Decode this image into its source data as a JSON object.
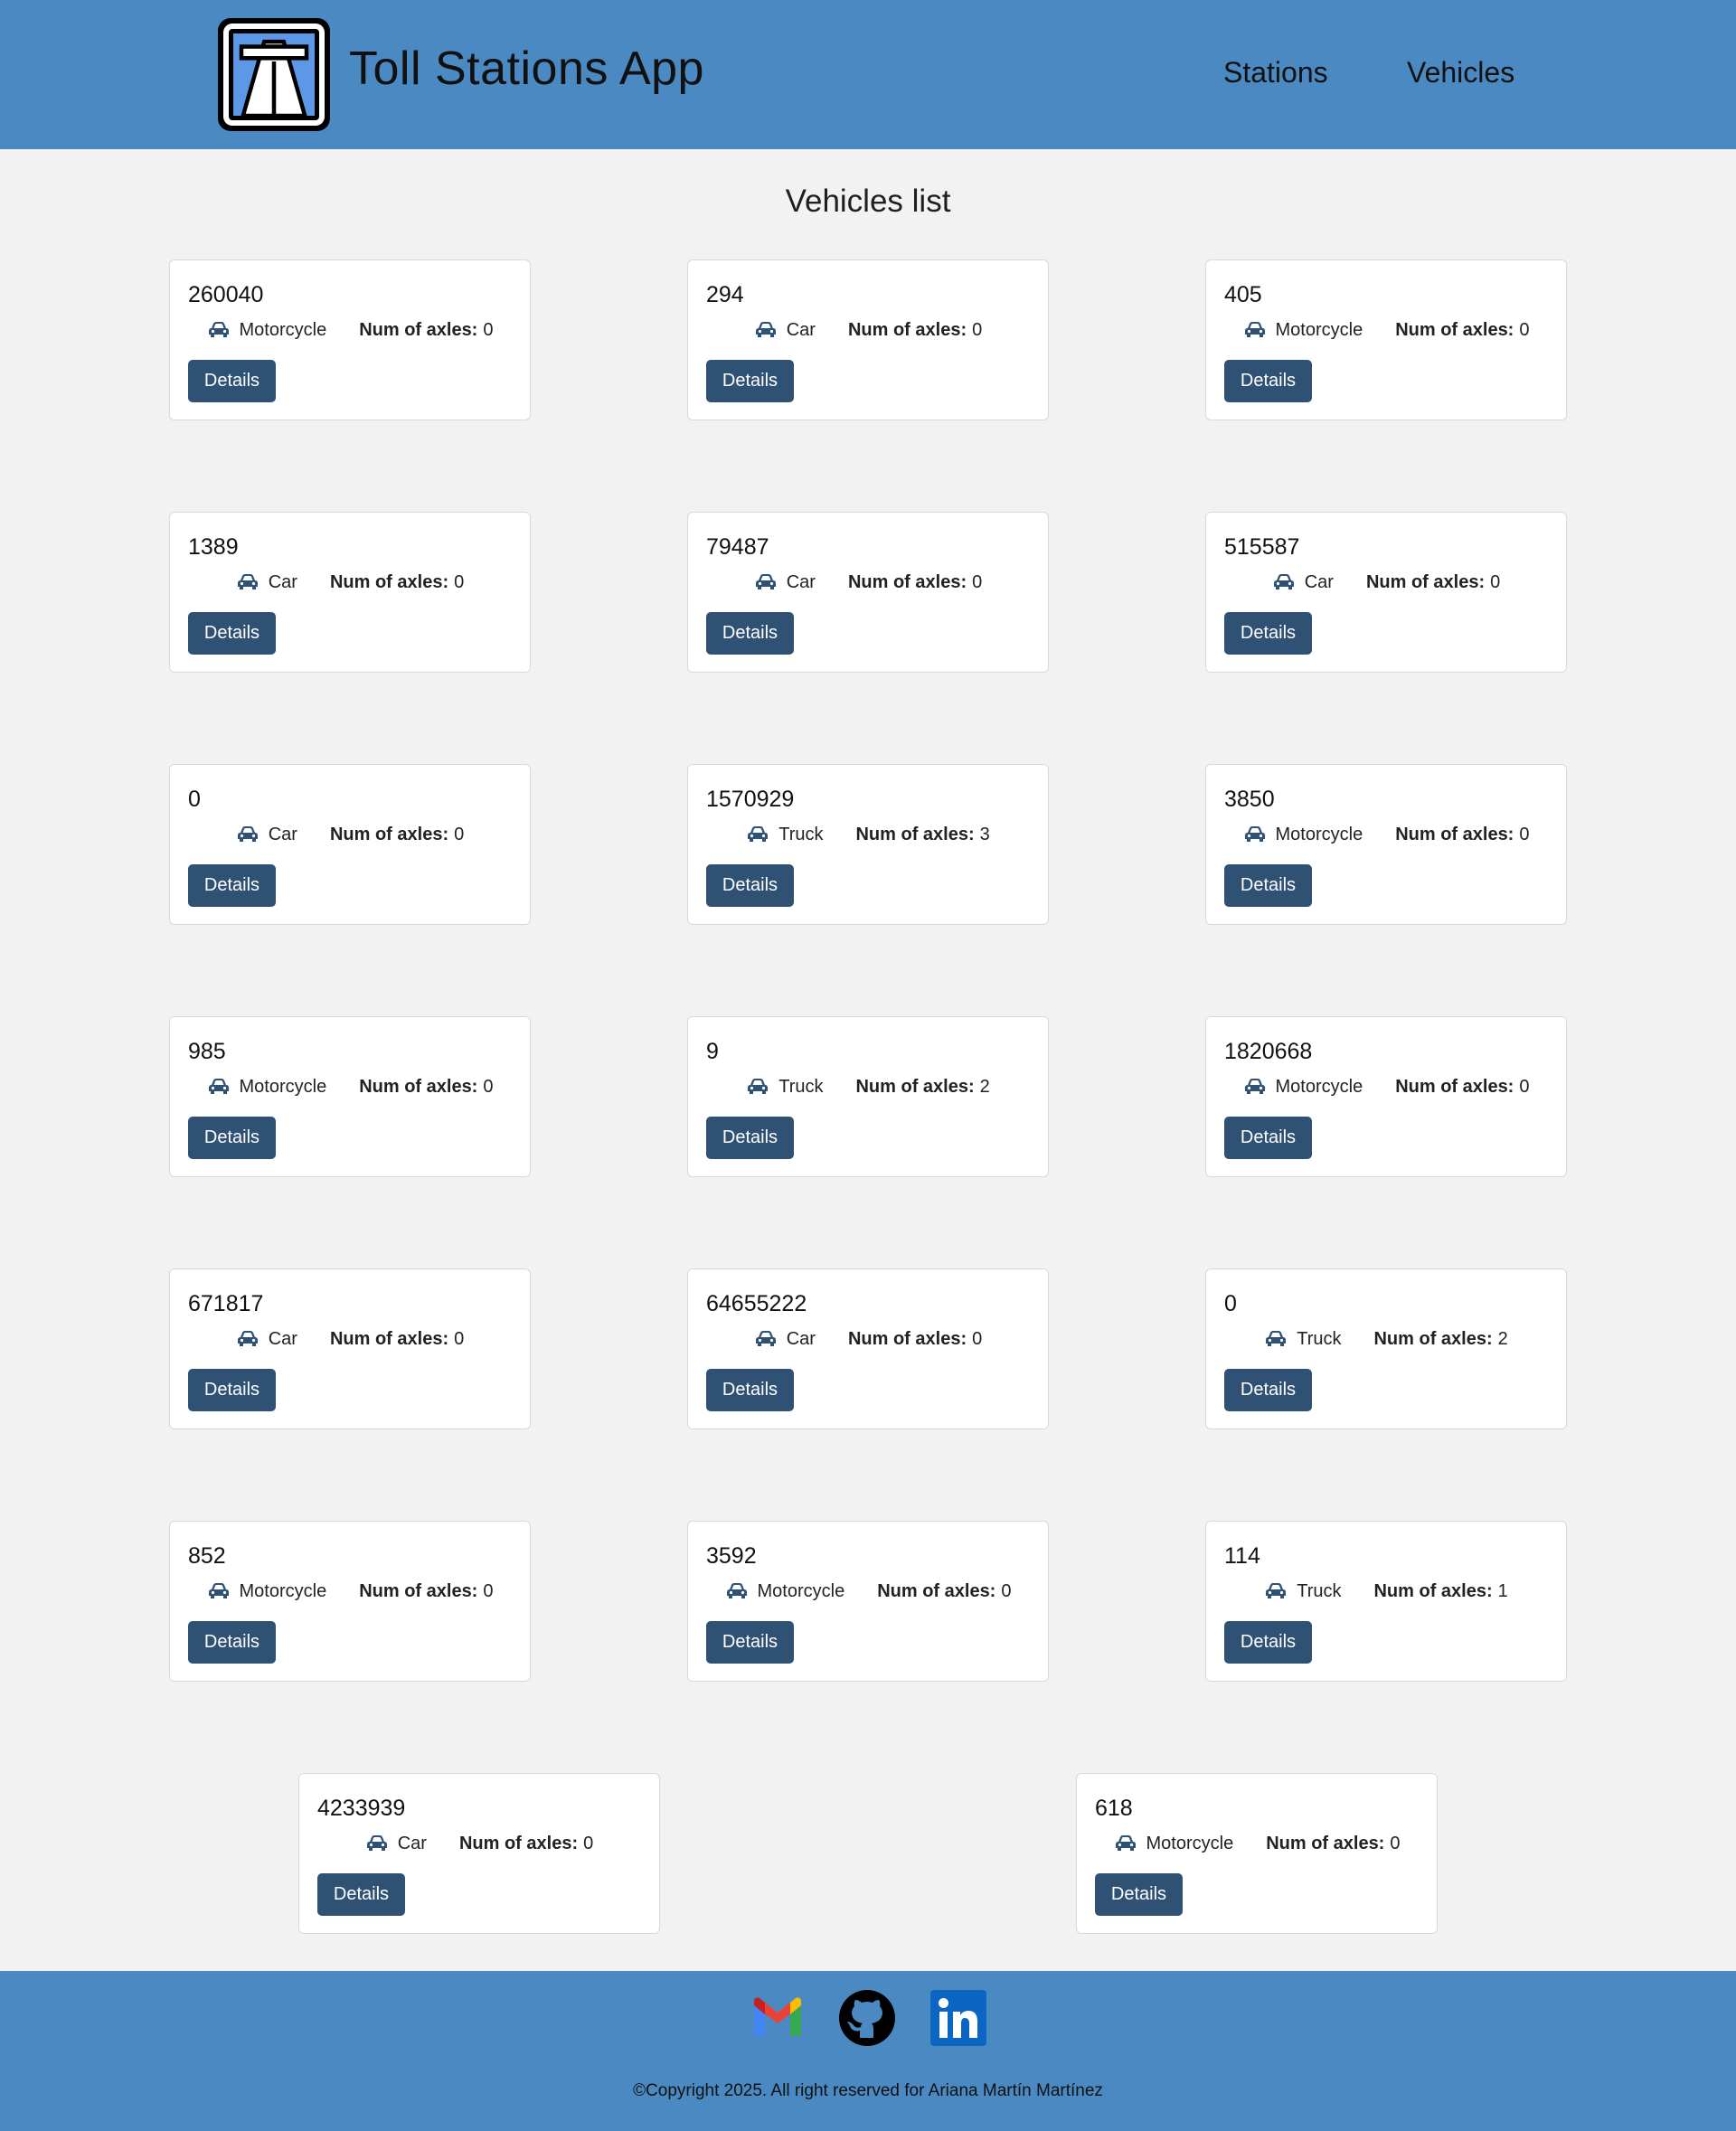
{
  "header": {
    "logo_icon": "highway-sign-icon",
    "app_title": "Toll Stations App",
    "nav": {
      "stations": "Stations",
      "vehicles": "Vehicles"
    }
  },
  "main": {
    "heading": "Vehicles list",
    "axles_label": "Num of axles:",
    "details_label": "Details",
    "vehicles": [
      {
        "number": "260040",
        "type": "Motorcycle",
        "axles": "0"
      },
      {
        "number": "294",
        "type": "Car",
        "axles": "0"
      },
      {
        "number": "405",
        "type": "Motorcycle",
        "axles": "0"
      },
      {
        "number": "1389",
        "type": "Car",
        "axles": "0"
      },
      {
        "number": "79487",
        "type": "Car",
        "axles": "0"
      },
      {
        "number": "515587",
        "type": "Car",
        "axles": "0"
      },
      {
        "number": "0",
        "type": "Car",
        "axles": "0"
      },
      {
        "number": "1570929",
        "type": "Truck",
        "axles": "3"
      },
      {
        "number": "3850",
        "type": "Motorcycle",
        "axles": "0"
      },
      {
        "number": "985",
        "type": "Motorcycle",
        "axles": "0"
      },
      {
        "number": "9",
        "type": "Truck",
        "axles": "2"
      },
      {
        "number": "1820668",
        "type": "Motorcycle",
        "axles": "0"
      },
      {
        "number": "671817",
        "type": "Car",
        "axles": "0"
      },
      {
        "number": "64655222",
        "type": "Car",
        "axles": "0"
      },
      {
        "number": "0",
        "type": "Truck",
        "axles": "2"
      },
      {
        "number": "852",
        "type": "Motorcycle",
        "axles": "0"
      },
      {
        "number": "3592",
        "type": "Motorcycle",
        "axles": "0"
      },
      {
        "number": "114",
        "type": "Truck",
        "axles": "1"
      },
      {
        "number": "4233939",
        "type": "Car",
        "axles": "0"
      },
      {
        "number": "618",
        "type": "Motorcycle",
        "axles": "0"
      }
    ]
  },
  "footer": {
    "social": [
      "gmail-icon",
      "github-icon",
      "linkedin-icon"
    ],
    "copyright": "©Copyright 2025. All right reserved for Ariana Martín Martínez"
  },
  "colors": {
    "header_bg": "#4a89c2",
    "page_bg": "#f2f2f2",
    "button_bg": "#2f5174",
    "icon_color": "#2f5174"
  }
}
